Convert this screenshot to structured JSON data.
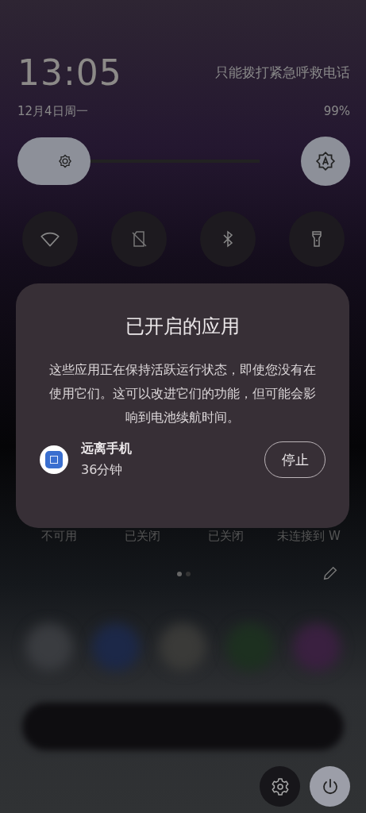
{
  "status": {
    "time": "13:05",
    "carrier": "只能拨打紧急呼救电话",
    "date": "12月4日周一",
    "battery": "99%"
  },
  "brightness": {
    "level": 0.3
  },
  "tiles": [
    {
      "kind": "wifi"
    },
    {
      "kind": "nosim"
    },
    {
      "kind": "bluetooth"
    },
    {
      "kind": "flashlight"
    }
  ],
  "tile_states": [
    "不可用",
    "已关闭",
    "已关闭",
    "未连接到 W"
  ],
  "dialog": {
    "title": "已开启的应用",
    "message": "这些应用正在保持活跃运行状态，即使您没有在使用它们。这可以改进它们的功能，但可能会影响到电池续航时间。",
    "apps": [
      {
        "name": "远离手机",
        "duration": "36分钟",
        "button": "停止"
      }
    ]
  },
  "pager": [
    {
      "selected": true
    },
    {
      "selected": false
    }
  ]
}
